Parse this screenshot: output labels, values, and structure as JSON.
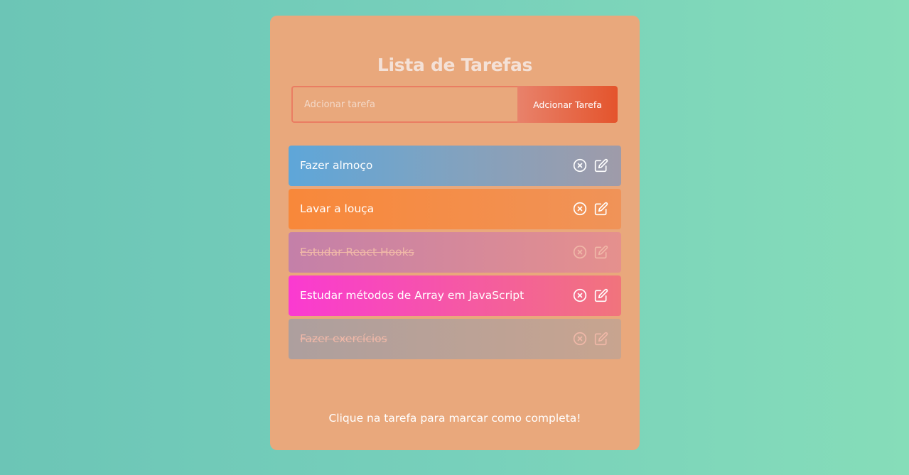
{
  "app": {
    "title": "Lista de Tarefas"
  },
  "form": {
    "input_placeholder": "Adcionar tarefa",
    "input_value": "",
    "add_button_label": "Adcionar Tarefa"
  },
  "todos": [
    {
      "text": "Fazer almoço",
      "completed": false,
      "color": "blue"
    },
    {
      "text": "Lavar a louça",
      "completed": false,
      "color": "orange"
    },
    {
      "text": "Estudar React Hooks",
      "completed": true,
      "color": "mauve"
    },
    {
      "text": "Estudar métodos de Array em JavaScript",
      "completed": false,
      "color": "pink"
    },
    {
      "text": "Fazer exercícios",
      "completed": true,
      "color": "grey"
    }
  ],
  "icons": {
    "remove": "close-circle-icon",
    "edit": "edit-icon"
  },
  "footer": {
    "hint": "Clique na tarefa para marcar como completa!"
  },
  "colors": {
    "background_start": "#6cc5b6",
    "background_end": "#86ddb9",
    "card": "#e9a87c",
    "button_start": "#e8826b",
    "button_end": "#e4542c"
  }
}
